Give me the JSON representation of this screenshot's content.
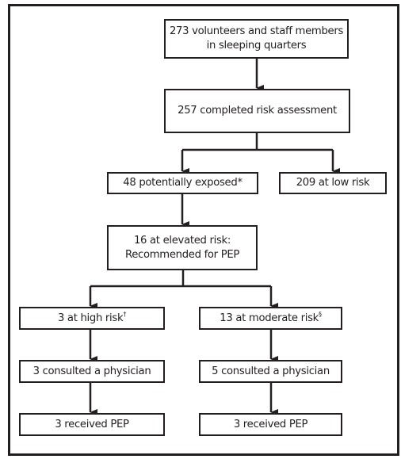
{
  "diagram": {
    "type": "flowchart",
    "nodes": [
      {
        "id": "all",
        "line1": "273 volunteers and staff members",
        "line2": "in sleeping quarters"
      },
      {
        "id": "assessed",
        "line1": "257 completed risk assessment"
      },
      {
        "id": "exposed",
        "line1": "48 potentially exposed*"
      },
      {
        "id": "low",
        "line1": "209 at low risk"
      },
      {
        "id": "elevated",
        "line1": "16 at elevated risk:",
        "line2": "Recommended for PEP"
      },
      {
        "id": "high",
        "line1": "3 at high risk",
        "mark": "†"
      },
      {
        "id": "moderate",
        "line1": "13 at moderate risk",
        "mark": "§"
      },
      {
        "id": "high_consulted",
        "line1": "3 consulted a physician"
      },
      {
        "id": "moderate_consulted",
        "line1": "5 consulted a physician"
      },
      {
        "id": "high_pep",
        "line1": "3 received PEP"
      },
      {
        "id": "moderate_pep",
        "line1": "3 received PEP"
      }
    ],
    "edges": [
      [
        "all",
        "assessed"
      ],
      [
        "assessed",
        "exposed"
      ],
      [
        "assessed",
        "low"
      ],
      [
        "exposed",
        "elevated"
      ],
      [
        "elevated",
        "high"
      ],
      [
        "elevated",
        "moderate"
      ],
      [
        "high",
        "high_consulted"
      ],
      [
        "moderate",
        "moderate_consulted"
      ],
      [
        "high_consulted",
        "high_pep"
      ],
      [
        "moderate_consulted",
        "moderate_pep"
      ]
    ],
    "colors": {
      "stroke": "#231f20",
      "fill": "#ffffff",
      "text": "#231f20"
    }
  }
}
